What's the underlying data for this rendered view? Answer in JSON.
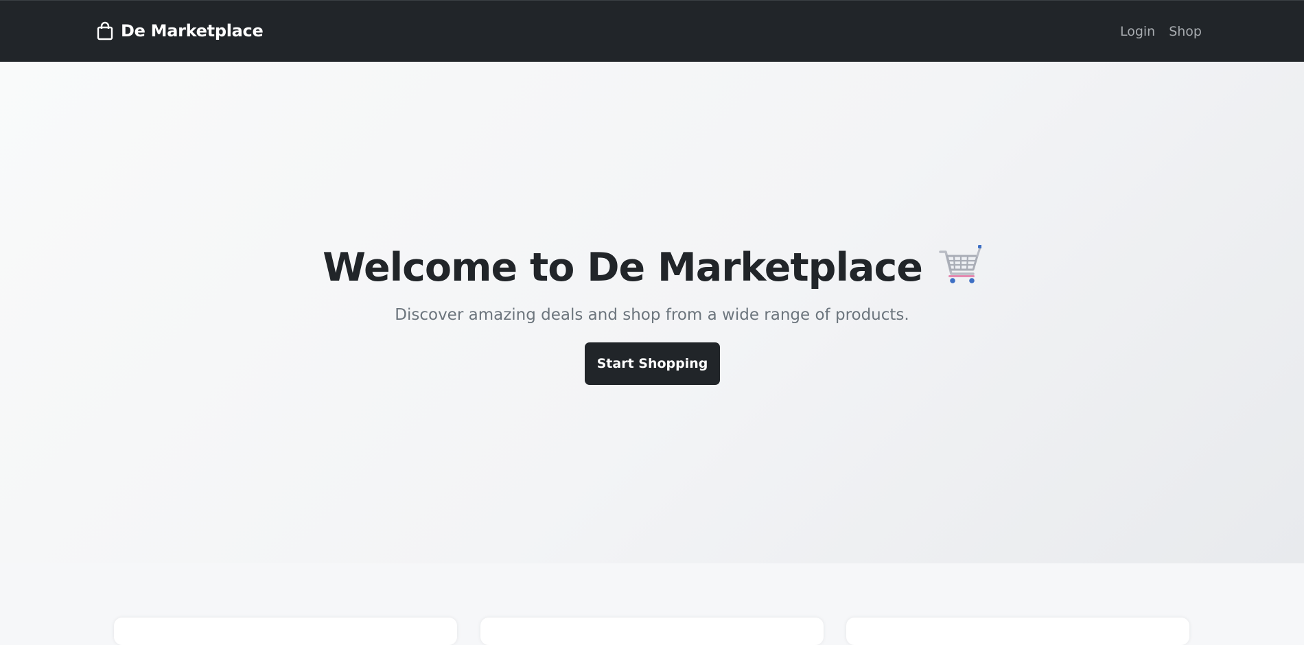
{
  "navbar": {
    "brand_icon": "shopping-bag-icon",
    "brand_name": "De Marketplace",
    "links": [
      {
        "label": "Login"
      },
      {
        "label": "Shop"
      }
    ]
  },
  "hero": {
    "title": "Welcome to De Marketplace",
    "title_icon": "shopping-cart-emoji",
    "subtitle": "Discover amazing deals and shop from a wide range of products.",
    "cta_label": "Start Shopping"
  },
  "colors": {
    "navbar_bg": "#212529",
    "cta_bg": "#212529",
    "muted_text": "#6c757d",
    "nav_link": "#a7abaf"
  }
}
